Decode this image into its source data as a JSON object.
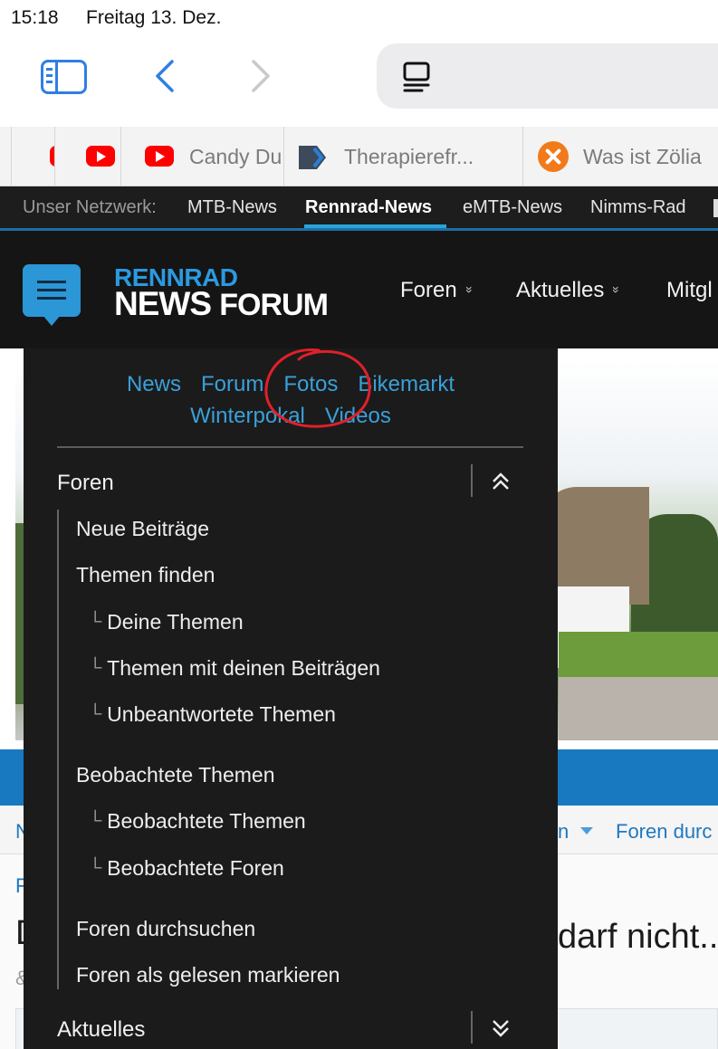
{
  "status_bar": {
    "time": "15:18",
    "date": "Freitag 13. Dez."
  },
  "browser": {
    "tabs": [
      {
        "label": "",
        "icon": "youtube-icon"
      },
      {
        "label": "",
        "icon": "youtube-icon"
      },
      {
        "label": "Candy Du",
        "icon": "youtube-icon"
      },
      {
        "label": "Therapierefr...",
        "icon": "therapie-icon"
      },
      {
        "label": "Was ist Zölia",
        "icon": "zoeliakie-icon"
      }
    ]
  },
  "network_bar": {
    "label": "Unser Netzwerk:",
    "links": [
      "MTB-News",
      "Rennrad-News",
      "eMTB-News",
      "Nimms-Rad"
    ],
    "active": "Rennrad-News",
    "accent_color": "#29a3d9"
  },
  "header": {
    "logo_top": "RENNRAD",
    "logo_bottom_1": "NEWS",
    "logo_bottom_2": "FORUM",
    "nav": [
      "Foren",
      "Aktuelles",
      "Mitgl"
    ],
    "nav_chevron": "»"
  },
  "dropdown": {
    "quick_links_row1": [
      "News",
      "Forum",
      "Fotos",
      "Bikemarkt"
    ],
    "quick_links_row2": [
      "Winterpokal",
      "Videos"
    ],
    "annotated_link": "Fotos",
    "sections": [
      {
        "title": "Foren",
        "expanded": true,
        "items": [
          {
            "label": "Neue Beiträge",
            "level": 1
          },
          {
            "label": "Themen finden",
            "level": 1
          },
          {
            "label": "Deine Themen",
            "level": 2
          },
          {
            "label": "Themen mit deinen Beiträgen",
            "level": 2
          },
          {
            "label": "Unbeantwortete Themen",
            "level": 2
          },
          {
            "label": "Beobachtete Themen",
            "level": 1
          },
          {
            "label": "Beobachtete Themen",
            "level": 2
          },
          {
            "label": "Beobachtete Foren",
            "level": 2
          },
          {
            "label": "Foren durchsuchen",
            "level": 1
          },
          {
            "label": "Foren als gelesen markieren",
            "level": 1
          }
        ]
      },
      {
        "title": "Aktuelles",
        "expanded": false
      }
    ],
    "tree_corner": "└"
  },
  "background_page": {
    "subnav_left": "N",
    "subnav_right_1": "n",
    "subnav_right_2": "Foren durc",
    "breadcrumb": "F",
    "title_left": "D",
    "title_right": "darf nicht...",
    "meta": "&"
  },
  "colors": {
    "link_blue": "#3aa0d9",
    "dark_panel": "#1b1b1b",
    "annotation_red": "#e0202a",
    "brand_blue": "#2b97d6"
  }
}
